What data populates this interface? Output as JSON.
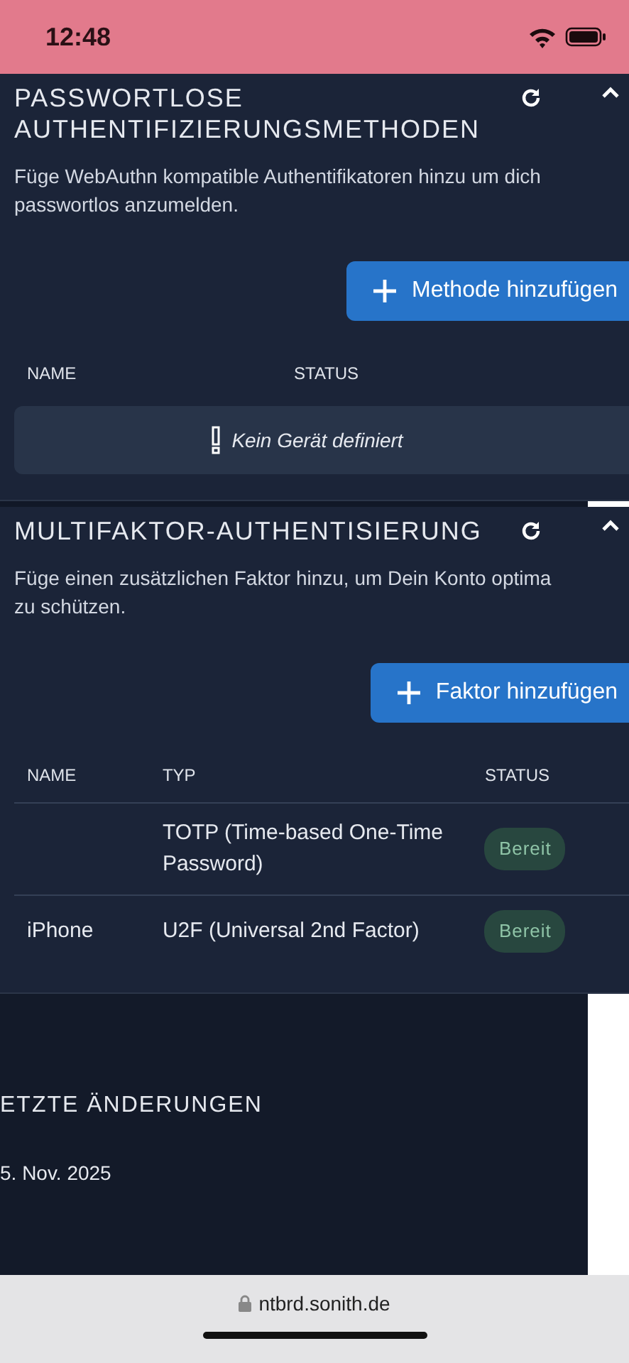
{
  "status_bar": {
    "time": "12:48"
  },
  "sections": [
    {
      "title": "PASSWORTLOSE AUTHENTIFIZIERUNGSMETHODEN",
      "description_lines": [
        "Füge WebAuthn kompatible Authentifikatoren hinzu um dich",
        "passwortlos anzumelden."
      ],
      "button": "Methode hinzufügen",
      "columns": [
        "NAME",
        "STATUS"
      ],
      "empty_message": "Kein Gerät definiert"
    },
    {
      "title": "MULTIFAKTOR-AUTHENTISIERUNG",
      "description_lines": [
        "Füge einen zusätzlichen Faktor hinzu, um Dein Konto optima",
        "zu schützen."
      ],
      "button": "Faktor hinzufügen",
      "columns": [
        "NAME",
        "TYP",
        "STATUS"
      ],
      "rows": [
        {
          "type": "TOTP (Time-based One-Time Password)",
          "status": "Bereit"
        },
        {
          "name": "iPhone",
          "type": "U2F (Universal 2nd Factor)",
          "status": "Bereit"
        }
      ]
    }
  ],
  "changes": {
    "title": "ETZTE ÄNDERUNGEN",
    "date": "5. Nov. 2025"
  },
  "browser": {
    "url": "ntbrd.sonith.de"
  }
}
